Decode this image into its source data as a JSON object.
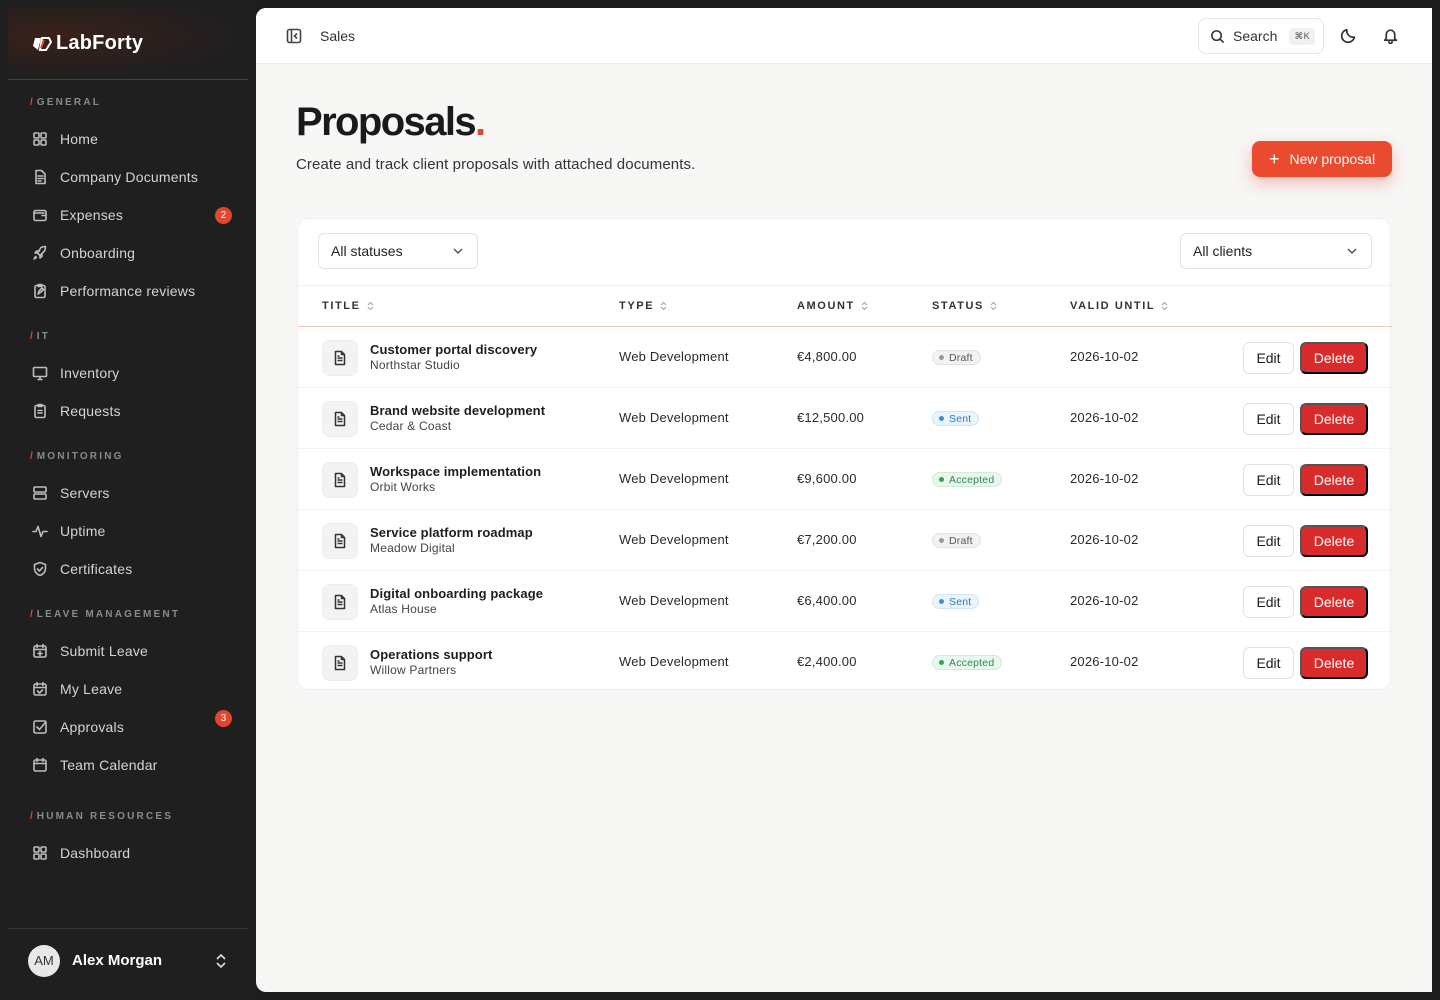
{
  "brand": {
    "name": "LabForty",
    "accent": "#e0472c"
  },
  "sidebar": {
    "sections": [
      {
        "label": "GENERAL",
        "items": [
          {
            "label": "Home",
            "icon": "grid-icon"
          },
          {
            "label": "Company Documents",
            "icon": "document-icon"
          },
          {
            "label": "Expenses",
            "icon": "wallet-icon",
            "badge": "2"
          },
          {
            "label": "Onboarding",
            "icon": "rocket-icon"
          },
          {
            "label": "Performance reviews",
            "icon": "clipboard-edit-icon"
          }
        ]
      },
      {
        "label": "IT",
        "items": [
          {
            "label": "Inventory",
            "icon": "monitor-icon"
          },
          {
            "label": "Requests",
            "icon": "clipboard-icon"
          }
        ]
      },
      {
        "label": "MONITORING",
        "items": [
          {
            "label": "Servers",
            "icon": "server-icon"
          },
          {
            "label": "Uptime",
            "icon": "activity-icon"
          },
          {
            "label": "Certificates",
            "icon": "shield-check-icon"
          }
        ]
      },
      {
        "label": "LEAVE MANAGEMENT",
        "items": [
          {
            "label": "Submit Leave",
            "icon": "calendar-plus-icon"
          },
          {
            "label": "My Leave",
            "icon": "calendar-check-icon"
          },
          {
            "label": "Approvals",
            "icon": "checkbox-icon",
            "badge": "3"
          },
          {
            "label": "Team Calendar",
            "icon": "calendar-icon"
          }
        ]
      },
      {
        "label": "HUMAN RESOURCES",
        "items": [
          {
            "label": "Dashboard",
            "icon": "grid-icon"
          }
        ]
      }
    ]
  },
  "user": {
    "initials": "AM",
    "name": "Alex Morgan"
  },
  "topbar": {
    "breadcrumb": "Sales",
    "search_label": "Search",
    "search_shortcut": "⌘K"
  },
  "page": {
    "title": "Proposals",
    "title_dot": ".",
    "subtitle": "Create and track client proposals with attached documents.",
    "new_button": "New proposal"
  },
  "filters": {
    "status": "All statuses",
    "client": "All clients"
  },
  "table": {
    "headers": {
      "title": "TITLE",
      "type": "TYPE",
      "amount": "AMOUNT",
      "status": "STATUS",
      "valid_until": "VALID UNTIL"
    },
    "edit_label": "Edit",
    "delete_label": "Delete",
    "rows": [
      {
        "title": "Customer portal discovery",
        "client": "Northstar Studio",
        "type": "Web Development",
        "amount": "€4,800.00",
        "status": "Draft",
        "valid_until": "2026-10-02"
      },
      {
        "title": "Brand website development",
        "client": "Cedar & Coast",
        "type": "Web Development",
        "amount": "€12,500.00",
        "status": "Sent",
        "valid_until": "2026-10-02"
      },
      {
        "title": "Workspace implementation",
        "client": "Orbit Works",
        "type": "Web Development",
        "amount": "€9,600.00",
        "status": "Accepted",
        "valid_until": "2026-10-02"
      },
      {
        "title": "Service platform roadmap",
        "client": "Meadow Digital",
        "type": "Web Development",
        "amount": "€7,200.00",
        "status": "Draft",
        "valid_until": "2026-10-02"
      },
      {
        "title": "Digital onboarding package",
        "client": "Atlas House",
        "type": "Web Development",
        "amount": "€6,400.00",
        "status": "Sent",
        "valid_until": "2026-10-02"
      },
      {
        "title": "Operations support",
        "client": "Willow Partners",
        "type": "Web Development",
        "amount": "€2,400.00",
        "status": "Accepted",
        "valid_until": "2026-10-02"
      }
    ]
  },
  "colors": {
    "primary": "#ea4a2e",
    "danger": "#d92b2b",
    "sidebar_bg": "#1f1f20",
    "status_draft": "#999999",
    "status_sent": "#3a8fd8",
    "status_accepted": "#36a15a"
  }
}
